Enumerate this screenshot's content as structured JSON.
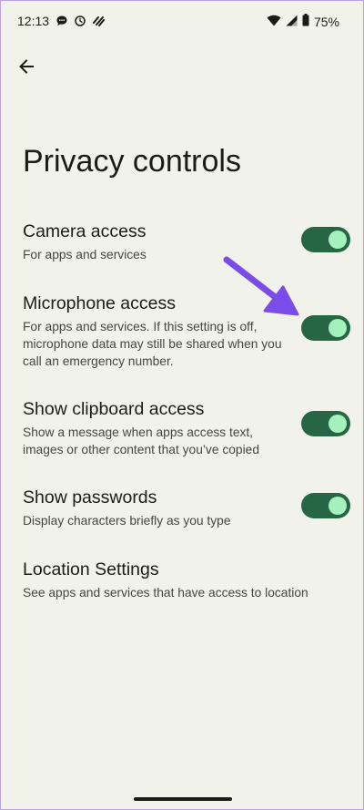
{
  "status_bar": {
    "time": "12:13",
    "battery_percent": "75%",
    "left_icons": [
      "chat-bubble-icon",
      "sync-clock-icon",
      "shazam-icon"
    ],
    "right_icons": [
      "wifi-icon",
      "cell-signal-icon",
      "battery-icon"
    ]
  },
  "header": {
    "back_icon": "arrow-left-icon"
  },
  "page": {
    "title": "Privacy controls"
  },
  "settings": [
    {
      "title": "Camera access",
      "description": "For apps and services",
      "toggle": true
    },
    {
      "title": "Microphone access",
      "description": "For apps and services. If this setting is off, microphone data may still be shared when you call an emergency number.",
      "toggle": true
    },
    {
      "title": "Show clipboard access",
      "description": "Show a message when apps access text, images or other content that you’ve copied",
      "toggle": true
    },
    {
      "title": "Show passwords",
      "description": "Display characters briefly as you type",
      "toggle": true
    },
    {
      "title": "Location Settings",
      "description": "See apps and services that have access to location",
      "toggle": null
    }
  ],
  "colors": {
    "background": "#f1f2ea",
    "toggle_track_on": "#276644",
    "toggle_knob_on": "#a4f1bd",
    "annotation_arrow": "#7b4de8"
  }
}
